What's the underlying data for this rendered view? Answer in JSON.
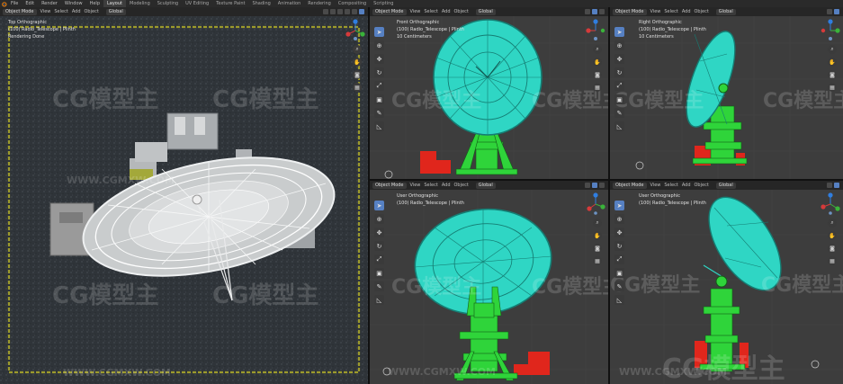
{
  "menubar": {
    "menus": [
      "File",
      "Edit",
      "Render",
      "Window",
      "Help"
    ],
    "workspaces": [
      "Layout",
      "Modeling",
      "Sculpting",
      "UV Editing",
      "Texture Paint",
      "Shading",
      "Animation",
      "Rendering",
      "Compositing",
      "Scripting"
    ],
    "active_workspace": "Layout"
  },
  "viewport_menu": {
    "mode": "Object Mode",
    "view": "View",
    "select": "Select",
    "add": "Add",
    "object": "Object",
    "orientation": "Global"
  },
  "viewports": {
    "main": {
      "title": "Top Orthographic",
      "object": "(100) Radio_Telescope | Plinth",
      "status": "Rendering Done"
    },
    "front": {
      "title": "Front Orthographic",
      "object": "(100) Radio_Telescope | Plinth",
      "scale": "10 Centimeters"
    },
    "right": {
      "title": "Right Orthographic",
      "object": "(100) Radio_Telescope | Plinth",
      "scale": "10 Centimeters"
    },
    "user_left": {
      "title": "User Orthographic",
      "object": "(100) Radio_Telescope | Plinth"
    },
    "user_right": {
      "title": "User Orthographic",
      "object": "(100) Radio_Telescope | Plinth"
    }
  },
  "watermark": {
    "brand": "CG模型主",
    "url": "WWW.CGMXW.COM"
  },
  "colors": {
    "wire": "#2fd6c4",
    "green": "#2fd43a",
    "red": "#e0261c",
    "viewport_bg": "#3d3d3d",
    "snow": "#2e3236",
    "accent": "#5680c2"
  }
}
